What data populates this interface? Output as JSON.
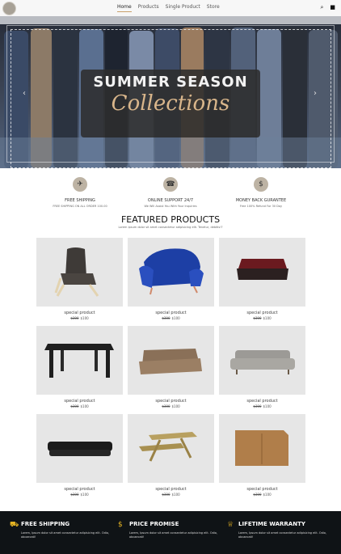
{
  "nav": {
    "links": [
      "Home",
      "Products",
      "Single Product",
      "Store"
    ],
    "icons": [
      "search-icon",
      "cart-icon"
    ]
  },
  "hero": {
    "title": "SUMMER SEASON",
    "subtitle": "Collections"
  },
  "features": [
    {
      "icon": "truck-icon",
      "title": "FREE SHIPPING",
      "text": "FREE SHIPPING ON ALL ORDER 100.00"
    },
    {
      "icon": "phone-icon",
      "title": "ONLINE SUPPORT 24/7",
      "text": "We Will Assist You With Your Inquiries"
    },
    {
      "icon": "dollar-icon",
      "title": "MONEY BACK GURANTEE",
      "text": "Free 100% Refund For 30 Day"
    }
  ],
  "featured": {
    "title": "FEATURED PRODUCTS",
    "subtitle": "Lorem ipsum dolor sit amet consectetur adipisicing elit. Tenetur, debitis!?"
  },
  "products": [
    {
      "name": "special product",
      "old_price": "$300",
      "price": "$100",
      "kind": "armchair"
    },
    {
      "name": "special product",
      "old_price": "$300",
      "price": "$100",
      "kind": "blue-armchair"
    },
    {
      "name": "special product",
      "old_price": "$300",
      "price": "$100",
      "kind": "bed"
    },
    {
      "name": "special product",
      "old_price": "$300",
      "price": "$100",
      "kind": "table"
    },
    {
      "name": "special product",
      "old_price": "$300",
      "price": "$100",
      "kind": "brown-sofa"
    },
    {
      "name": "special product",
      "old_price": "$300",
      "price": "$100",
      "kind": "grey-sofa"
    },
    {
      "name": "special product",
      "old_price": "$300",
      "price": "$100",
      "kind": "leather-sofa"
    },
    {
      "name": "special product",
      "old_price": "$300",
      "price": "$100",
      "kind": "picnic-table"
    },
    {
      "name": "special product",
      "old_price": "$300",
      "price": "$100",
      "kind": "cabinet"
    }
  ],
  "footer": [
    {
      "icon": "truck-icon",
      "title": "FREE SHIPPING",
      "text": "Lorem, Ipsum dolor sit amet consectetur adipisicing elit. Odio, obcaecati!"
    },
    {
      "icon": "dollar-icon",
      "title": "PRICE PROMISE",
      "text": "Lorem, Ipsum dolor sit amet consectetur adipisicing elit. Odio, obcaecati!"
    },
    {
      "icon": "trophy-icon",
      "title": "LIFETIME WARRANTY",
      "text": "Lorem, Ipsum dolor sit amet consectetur adipisicing elit. Odio, obcaecati!"
    }
  ]
}
